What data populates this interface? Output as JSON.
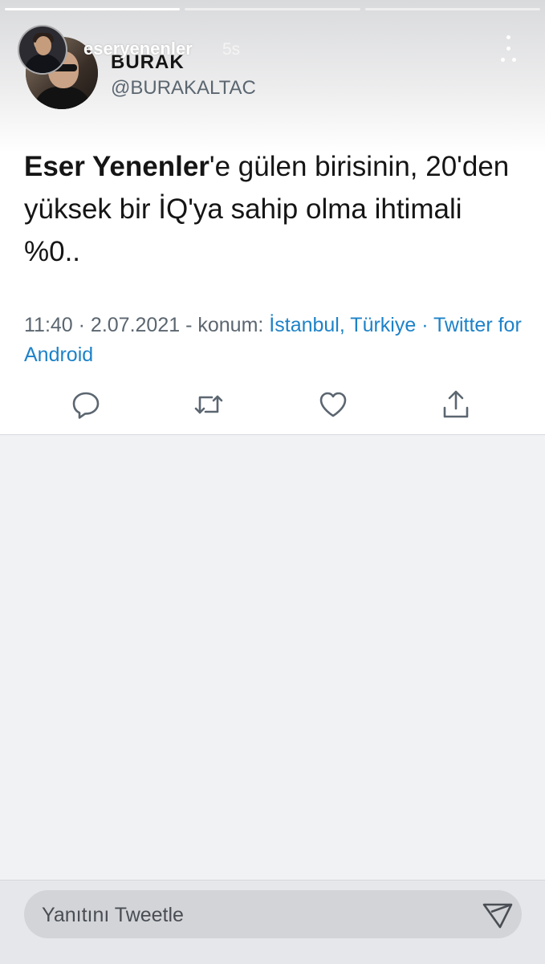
{
  "story": {
    "username": "eseryenenler",
    "time_ago": "5s",
    "progress_segments": 3,
    "active_segment": 0
  },
  "tweet": {
    "author_name": "BURAK",
    "author_handle": "@BURAKALTAC",
    "text_bold": "Eser Yenenler",
    "text_rest": "'e gülen birisinin, 20'den yüksek bir İQ'ya sahip olma ihtimali %0..",
    "meta_prefix": "11:40 · 2.07.2021 - konum: ",
    "location": "İstanbul, Türkiye",
    "meta_sep": " · ",
    "source": "Twitter for Android"
  },
  "actions": [
    {
      "name": "reply",
      "icon": "comment-icon"
    },
    {
      "name": "retweet",
      "icon": "retweet-icon"
    },
    {
      "name": "like",
      "icon": "heart-icon"
    },
    {
      "name": "share",
      "icon": "share-icon"
    }
  ],
  "reply_bar": {
    "placeholder": "Yanıtını Tweetle"
  },
  "colors": {
    "link": "#1d82c8",
    "secondary_text": "#5b6670",
    "icon": "#5b6670"
  }
}
